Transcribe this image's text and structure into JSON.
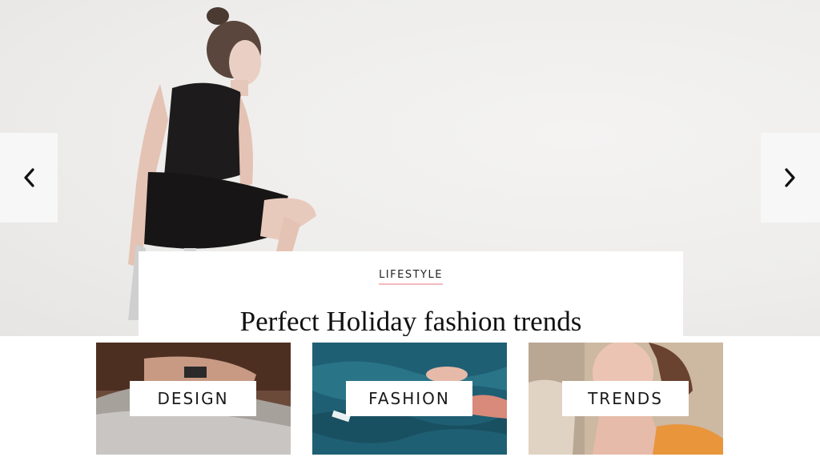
{
  "slider": {
    "prev_icon": "chevron-left-icon",
    "next_icon": "chevron-right-icon",
    "slide": {
      "category": "LIFESTYLE",
      "title": "Perfect Holiday fashion trends"
    }
  },
  "tiles": [
    {
      "label": "DESIGN"
    },
    {
      "label": "FASHION"
    },
    {
      "label": "TRENDS"
    }
  ],
  "colors": {
    "accent_underline": "#f3b9bd",
    "pool_water": "#1f5f74"
  }
}
